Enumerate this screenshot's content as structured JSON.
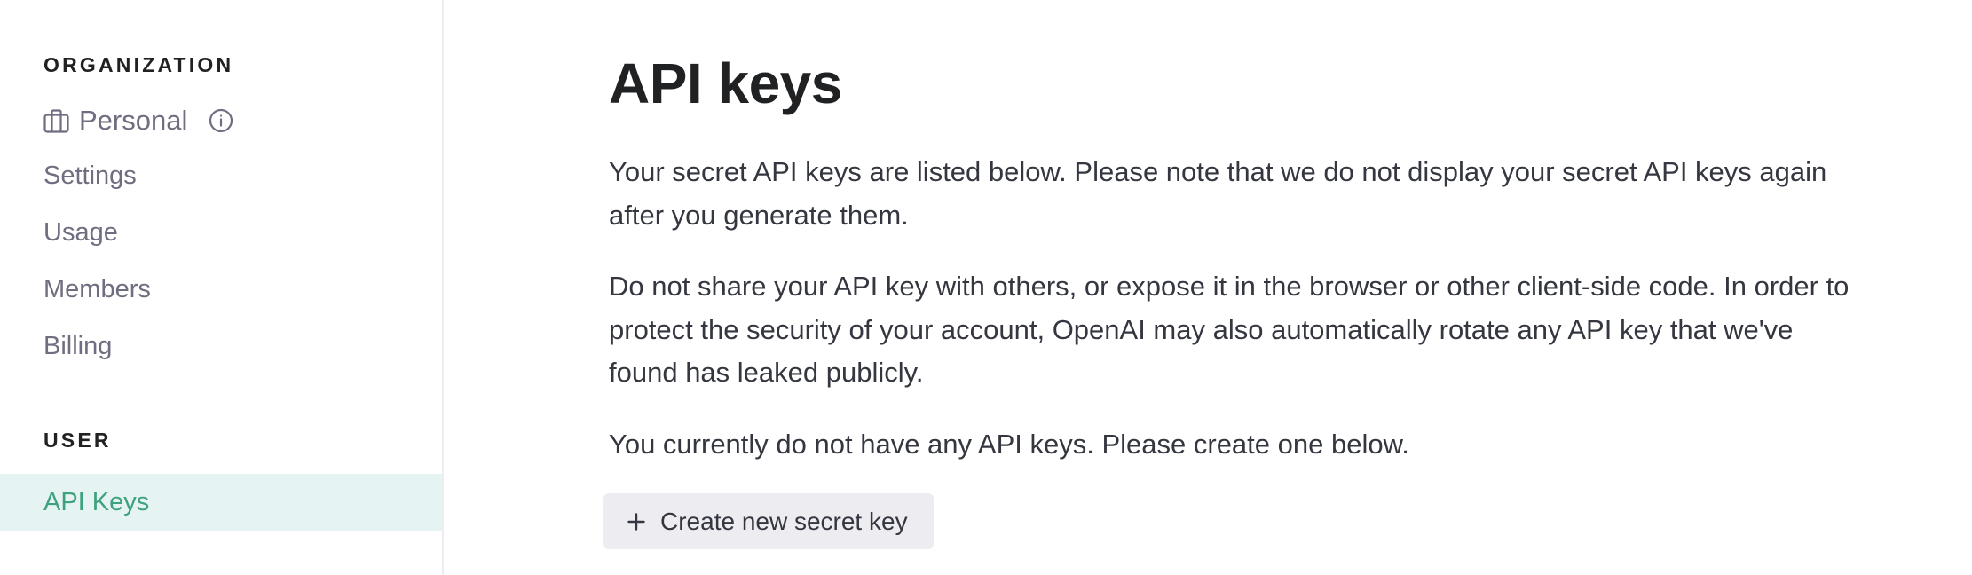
{
  "sidebar": {
    "organization_heading": "ORGANIZATION",
    "organization": {
      "name": "Personal",
      "icon": "briefcase-icon",
      "info_icon": "info-icon"
    },
    "organization_items": [
      {
        "label": "Settings"
      },
      {
        "label": "Usage"
      },
      {
        "label": "Members"
      },
      {
        "label": "Billing"
      }
    ],
    "user_heading": "USER",
    "user_items": [
      {
        "label": "API Keys",
        "active": true
      }
    ]
  },
  "main": {
    "title": "API keys",
    "paragraphs": [
      {
        "lines": [
          "Your secret API keys are listed below. Please note that we do not display your secret API keys again",
          "after you generate them."
        ]
      },
      {
        "lines": [
          "Do not share your API key with others, or expose it in the browser or other client-side code. In order to",
          "protect the security of your account, OpenAI may also automatically rotate any API key that we've",
          "found has leaked publicly."
        ]
      },
      {
        "lines": [
          "You currently do not have any API keys. Please create one below."
        ]
      }
    ],
    "create_button": {
      "label": "Create new secret key",
      "icon": "plus-icon"
    }
  },
  "colors": {
    "accent": "#3FA27E",
    "active_bg": "#E6F3F3",
    "muted_text": "#6E6E80",
    "body_text": "#353740",
    "heading_text": "#202123",
    "button_bg": "#ECECF1",
    "divider": "#ECECF1"
  }
}
